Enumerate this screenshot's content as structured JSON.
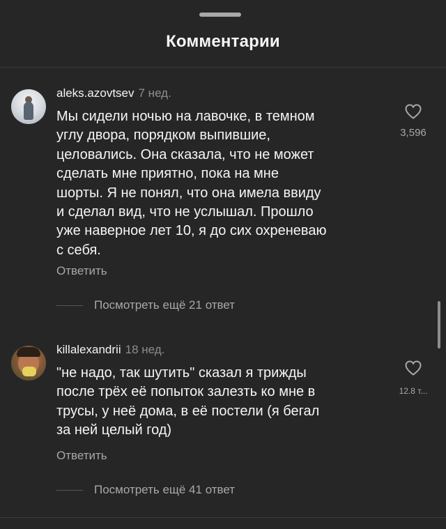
{
  "sheet": {
    "title": "Комментарии"
  },
  "comments": [
    {
      "username": "aleks.azovtsev",
      "time": "7 нед.",
      "text": "Мы сидели ночью на лавочке, в темном\nуглу двора, порядком выпившие,\nцеловались. Она сказала, что не может\nсделать мне приятно, пока на мне\nшорты. Я не понял, что она имела ввиду\nи сделал вид, что не услышал. Прошло\nуже наверное лет 10, я до сих охреневаю\nс себя.",
      "reply_label": "Ответить",
      "view_replies": "Посмотреть ещё 21 ответ",
      "likes": "3,596",
      "like_icon": "heart-outline-icon"
    },
    {
      "username": "killalexandrii",
      "time": "18 нед.",
      "text": "\"не надо, так шутить\" сказал я трижды\nпосле трёх её попыток залезть ко мне в\nтрусы, у неё дома, в её постели (я бегал\nза ней целый год)",
      "reply_label": "Ответить",
      "view_replies": "Посмотреть ещё 41 ответ",
      "likes": "12.8 т...",
      "like_icon": "heart-outline-icon"
    }
  ],
  "colors": {
    "background": "#262626",
    "primary_text": "#f5f5f5",
    "secondary_text": "#a8a8a8",
    "muted_text": "#8e8e8e"
  }
}
